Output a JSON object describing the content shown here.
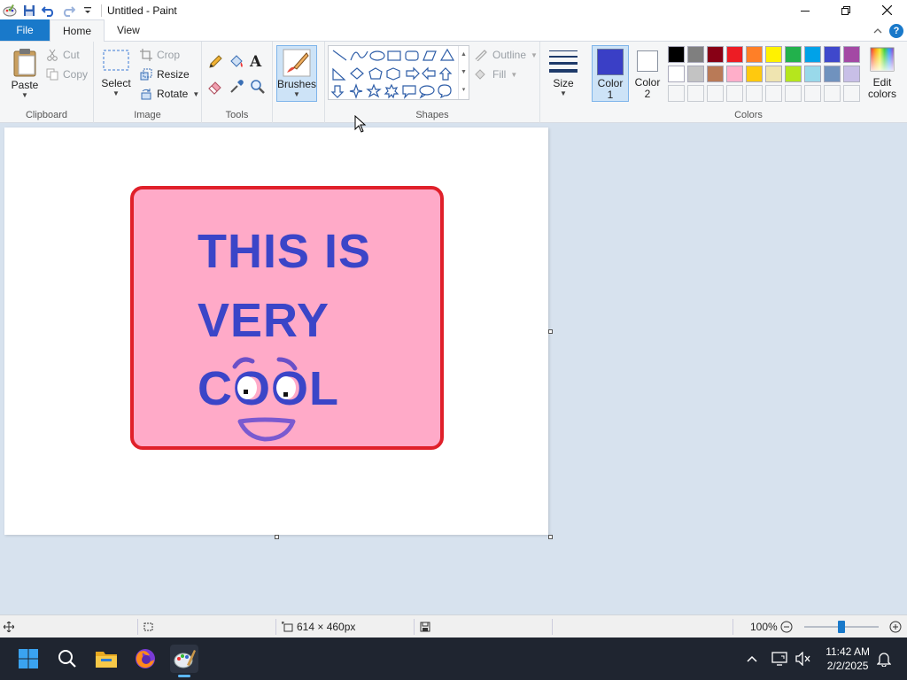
{
  "window": {
    "title": "Untitled - Paint"
  },
  "tabs": {
    "file": "File",
    "home": "Home",
    "view": "View"
  },
  "clipboard": {
    "label": "Clipboard",
    "paste": "Paste",
    "cut": "Cut",
    "copy": "Copy"
  },
  "image": {
    "label": "Image",
    "select": "Select",
    "crop": "Crop",
    "resize": "Resize",
    "rotate": "Rotate"
  },
  "tools": {
    "label": "Tools"
  },
  "brushes": {
    "label": "Brushes"
  },
  "shapes": {
    "label": "Shapes",
    "outline": "Outline",
    "fill": "Fill"
  },
  "size": {
    "label": "Size"
  },
  "color1": {
    "label_line1": "Color",
    "label_line2": "1",
    "value": "#3a3fc6"
  },
  "color2": {
    "label_line1": "Color",
    "label_line2": "2",
    "value": "#ffffff"
  },
  "colors": {
    "label": "Colors",
    "edit_line1": "Edit",
    "edit_line2": "colors",
    "row1": [
      "#000000",
      "#7f7f7f",
      "#880015",
      "#ed1c24",
      "#ff7f27",
      "#fff200",
      "#22b14c",
      "#00a2e8",
      "#3f48cc",
      "#a349a4"
    ],
    "row2": [
      "#ffffff",
      "#c3c3c3",
      "#b97a57",
      "#ffaec9",
      "#ffc90e",
      "#efe4b0",
      "#b5e61d",
      "#99d9ea",
      "#7092be",
      "#c8bfe7"
    ]
  },
  "drawing": {
    "line1": "THIS IS",
    "line2": "VERY",
    "line3": "COOL",
    "bg": "#ffaac8",
    "border": "#e0202a",
    "text_color": "#3b45c8"
  },
  "status": {
    "dimensions": "614 × 460px",
    "zoom": "100%"
  },
  "taskbar": {
    "time": "11:42 AM",
    "date": "2/2/2025"
  }
}
